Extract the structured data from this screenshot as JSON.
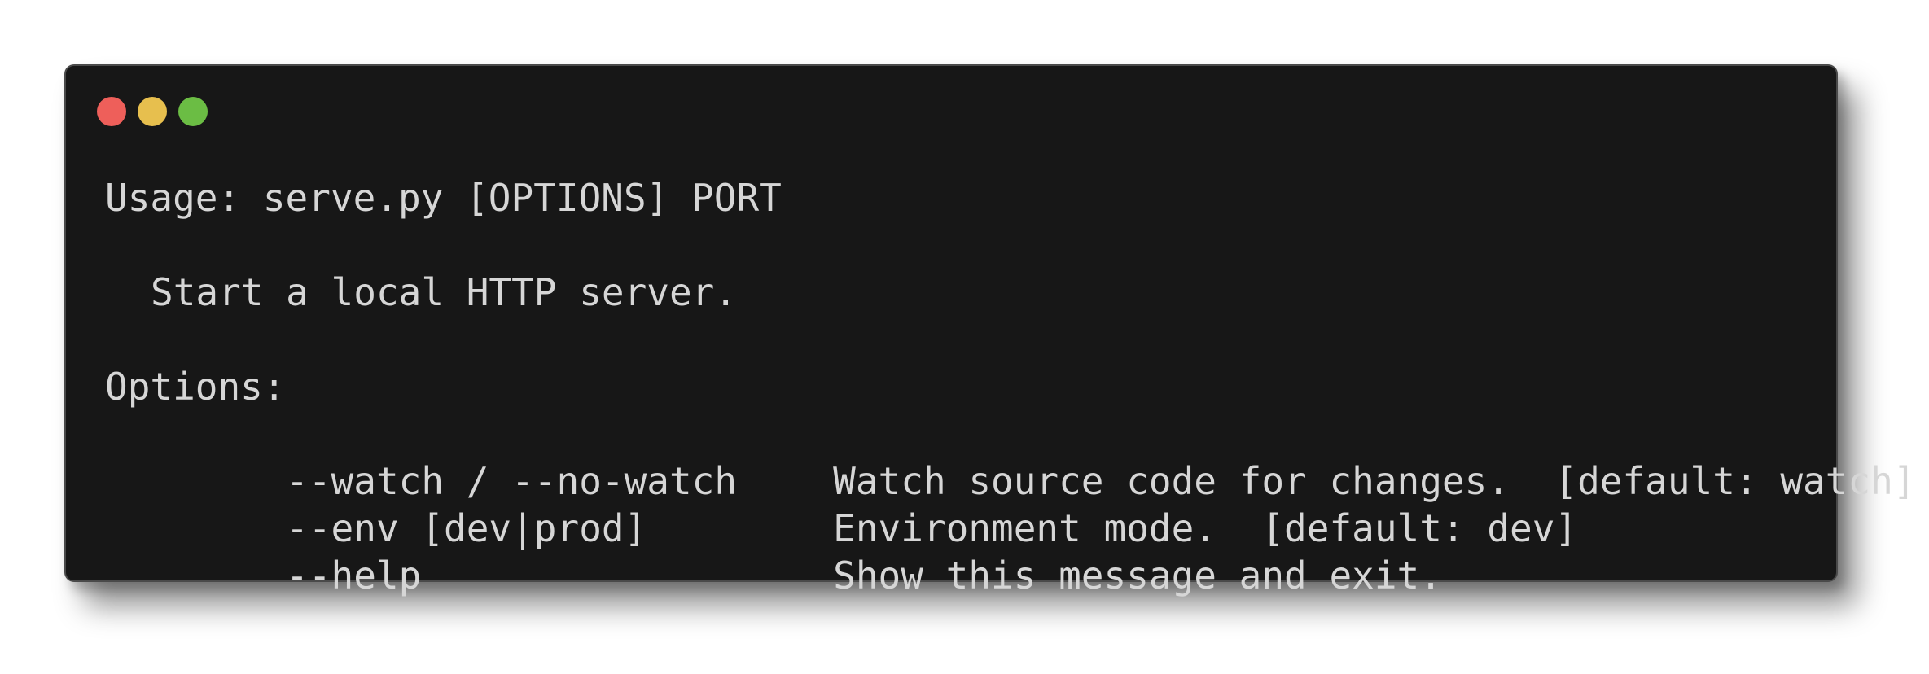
{
  "window": {
    "controls": [
      {
        "name": "close",
        "color": "#ee5f5a"
      },
      {
        "name": "minimize",
        "color": "#e7bf4e"
      },
      {
        "name": "maximize",
        "color": "#6bbd44"
      }
    ],
    "background": "#171717",
    "text_color": "#d6d6d6"
  },
  "terminal": {
    "usage_line": "Usage: serve.py [OPTIONS] PORT",
    "description": "Start a local HTTP server.",
    "options_header": "Options:",
    "options": [
      {
        "flag": "--watch / --no-watch",
        "description": "Watch source code for changes.  [default: watch]"
      },
      {
        "flag": "--env [dev|prod]",
        "description": "Environment mode.  [default: dev]"
      },
      {
        "flag": "--help",
        "description": "Show this message and exit."
      }
    ]
  }
}
